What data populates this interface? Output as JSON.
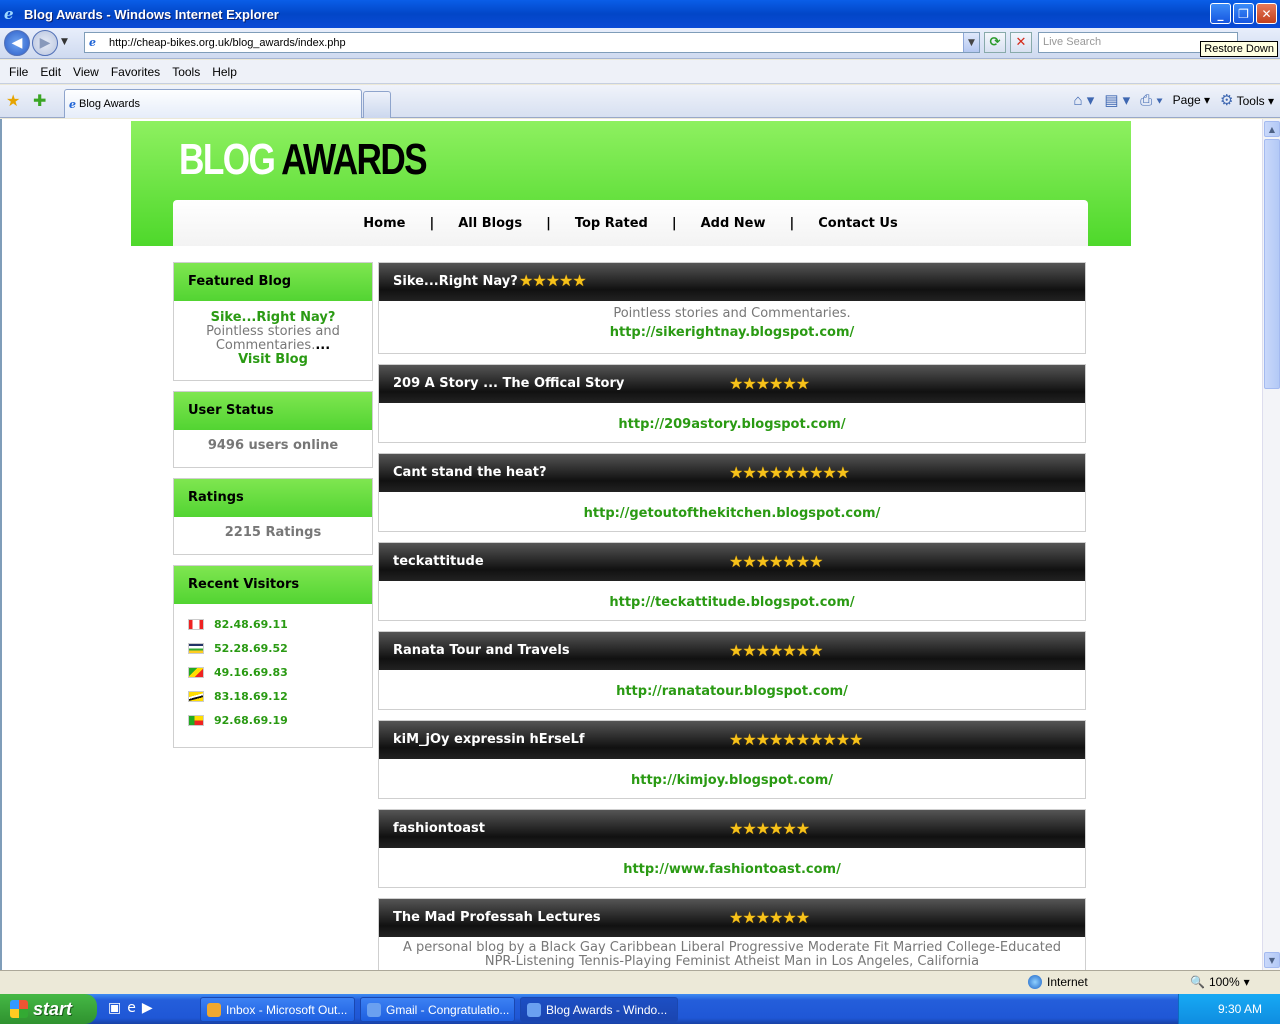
{
  "window": {
    "title": "Blog Awards - Windows Internet Explorer",
    "tooltip": "Restore Down"
  },
  "address": {
    "url": "http://cheap-bikes.org.uk/blog_awards/index.php",
    "search_placeholder": "Live Search"
  },
  "menu": [
    "File",
    "Edit",
    "View",
    "Favorites",
    "Tools",
    "Help"
  ],
  "tab": {
    "label": "Blog Awards"
  },
  "toolbar": {
    "page": "Page",
    "tools": "Tools"
  },
  "site": {
    "logo_white": "BLOG",
    "logo_black": "AWARDS",
    "nav": [
      "Home",
      "All Blogs",
      "Top Rated",
      "Add New",
      "Contact Us"
    ],
    "nav_sep": "|"
  },
  "sidebar": {
    "featured": {
      "heading": "Featured Blog",
      "title": "Sike...Right Nay?",
      "desc": "Pointless stories and Commentaries.",
      "ellipsis": "...",
      "visit": "Visit Blog"
    },
    "status": {
      "heading": "User Status",
      "text": "9496 users online"
    },
    "ratings": {
      "heading": "Ratings",
      "text": "2215 Ratings"
    },
    "visitors": {
      "heading": "Recent Visitors",
      "items": [
        {
          "ip": "82.48.69.11",
          "flag": "canada"
        },
        {
          "ip": "52.28.69.52",
          "flag": "central-african-republic"
        },
        {
          "ip": "49.16.69.83",
          "flag": "congo"
        },
        {
          "ip": "83.18.69.12",
          "flag": "brunei"
        },
        {
          "ip": "92.68.69.19",
          "flag": "benin"
        }
      ]
    }
  },
  "entries": [
    {
      "title": "Sike...Right Nay?",
      "stars": 5,
      "desc": "Pointless stories and Commentaries.",
      "url": "http://sikerightnay.blogspot.com/"
    },
    {
      "title": "209 A Story ... The Offical Story",
      "stars": 6,
      "desc": "",
      "url": "http://209astory.blogspot.com/"
    },
    {
      "title": "Cant stand the heat?",
      "stars": 9,
      "desc": "",
      "url": "http://getoutofthekitchen.blogspot.com/"
    },
    {
      "title": "teckattitude",
      "stars": 7,
      "desc": "",
      "url": "http://teckattitude.blogspot.com/"
    },
    {
      "title": "Ranata Tour and Travels",
      "stars": 7,
      "desc": "",
      "url": "http://ranatatour.blogspot.com/"
    },
    {
      "title": "kiM_jOy expressin hErseLf",
      "stars": 10,
      "desc": "",
      "url": "http://kimjoy.blogspot.com/"
    },
    {
      "title": "fashiontoast",
      "stars": 6,
      "desc": "",
      "url": "http://www.fashiontoast.com/"
    },
    {
      "title": "The Mad Professah Lectures",
      "stars": 6,
      "desc": "A personal blog by a Black Gay Caribbean Liberal Progressive Moderate Fit Married College-Educated NPR-Listening Tennis-Playing Feminist Atheist Man in Los Angeles, California",
      "url": ""
    }
  ],
  "statusbar": {
    "zone": "Internet",
    "zoom": "100%"
  },
  "taskbar": {
    "start": "start",
    "tasks": [
      "Inbox - Microsoft Out...",
      "Gmail - Congratulatio...",
      "Blog Awards - Windo..."
    ],
    "clock": "9:30 AM"
  }
}
